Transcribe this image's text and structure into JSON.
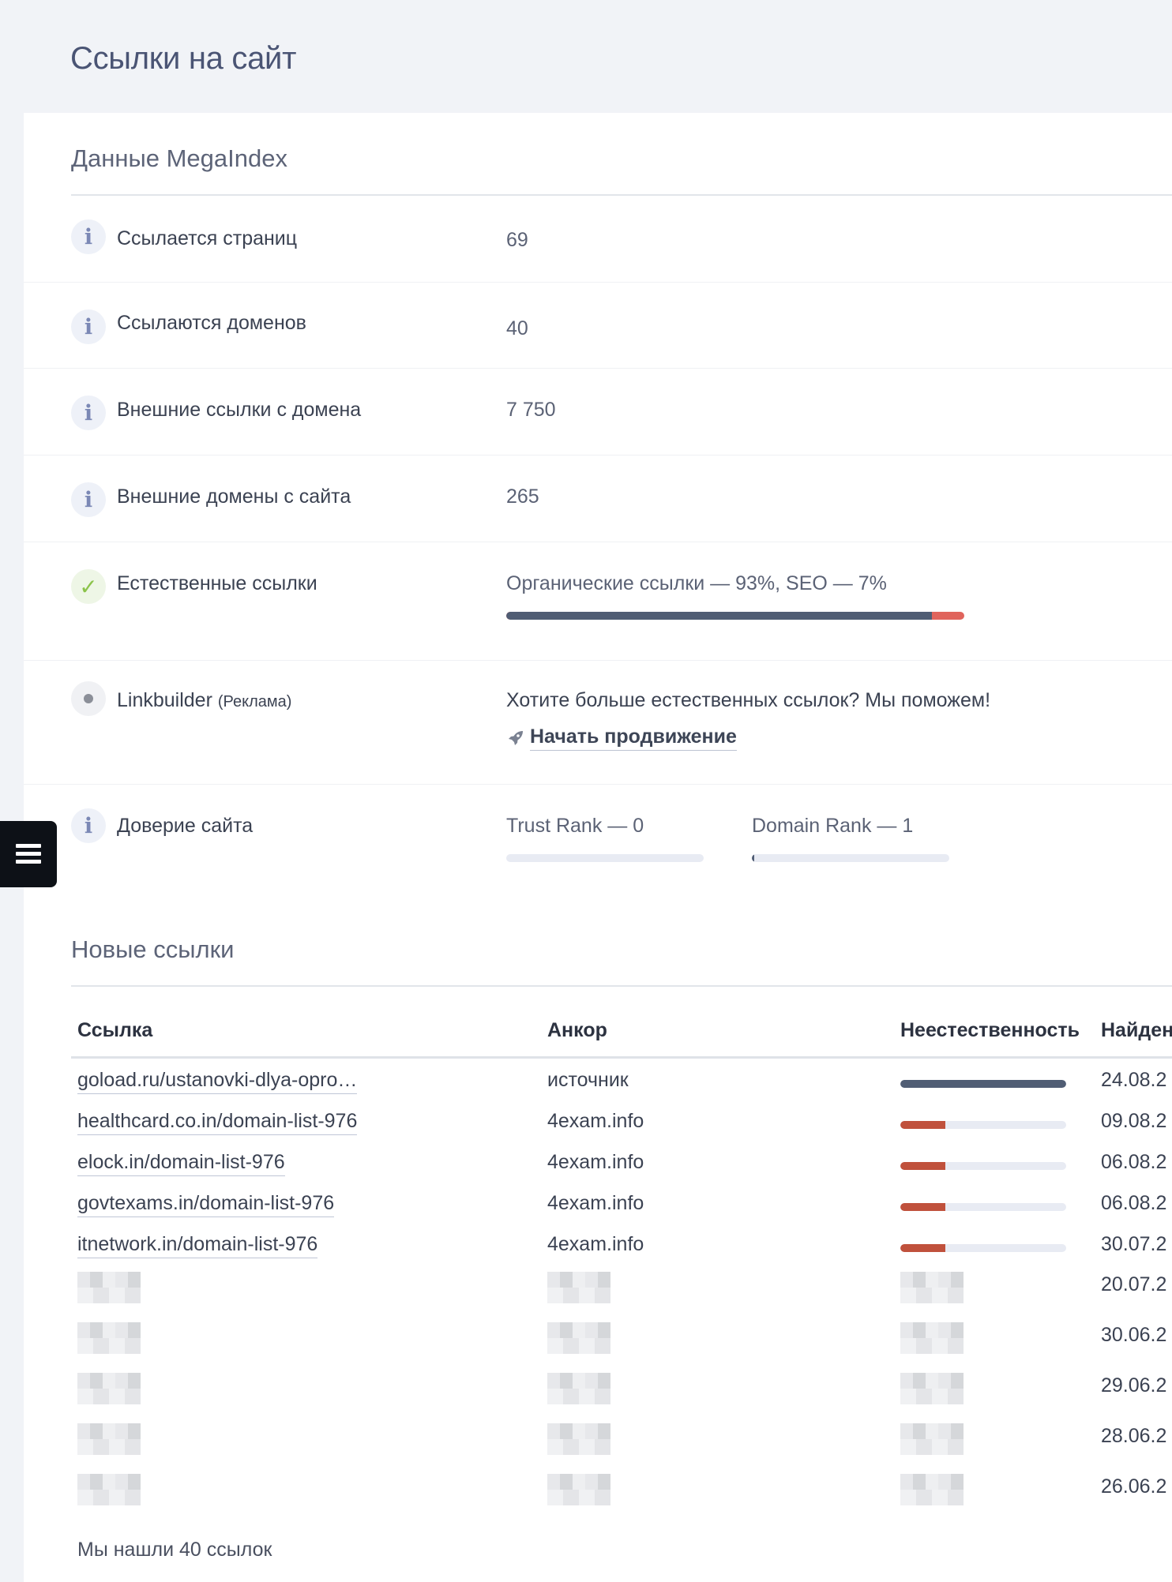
{
  "page": {
    "title": "Ссылки на сайт"
  },
  "megaindex": {
    "title": "Данные MegaIndex",
    "rows": [
      {
        "label": "Ссылается страниц",
        "value": "69"
      },
      {
        "label": "Ссылаются доменов",
        "value": "40"
      },
      {
        "label": "Внешние ссылки с домена",
        "value": "7 750"
      },
      {
        "label": "Внешние домены с сайта",
        "value": "265"
      }
    ],
    "natural": {
      "label": "Естественные ссылки",
      "text": "Органические ссылки — 93%, SEO — 7%",
      "organic_fraction": 0.93,
      "seo_fraction": 0.07,
      "colors": {
        "organic": "#505d74",
        "seo": "#e0645c"
      }
    },
    "linkbuilder": {
      "label": "Linkbuilder",
      "label_note": "(Реклама)",
      "text": "Хотите больше естественных ссылок? Мы поможем!",
      "cta": "Начать продвижение",
      "cta_icon": "rocket-icon"
    },
    "trust": {
      "label": "Доверие сайта",
      "trust_rank": "Trust Rank — 0",
      "trust_rank_value": 0,
      "domain_rank": "Domain Rank — 1",
      "domain_rank_value": 1
    }
  },
  "new_links": {
    "title": "Новые ссылки",
    "columns": [
      "Ссылка",
      "Анкор",
      "Неестественность",
      "Найден"
    ],
    "rows": [
      {
        "link": "goload.ru/ustanovki-dlya-opro…",
        "anchor": "источник",
        "unnatural": 1.0,
        "bar_color": "#505d74",
        "date": "24.08.2"
      },
      {
        "link": "healthcard.co.in/domain-list-976",
        "anchor": "4exam.info",
        "unnatural": 0.27,
        "bar_color": "#c0513c",
        "date": "09.08.2"
      },
      {
        "link": "elock.in/domain-list-976",
        "anchor": "4exam.info",
        "unnatural": 0.27,
        "bar_color": "#c0513c",
        "date": "06.08.2"
      },
      {
        "link": "govtexams.in/domain-list-976",
        "anchor": "4exam.info",
        "unnatural": 0.27,
        "bar_color": "#c0513c",
        "date": "06.08.2"
      },
      {
        "link": "itnetwork.in/domain-list-976",
        "anchor": "4exam.info",
        "unnatural": 0.27,
        "bar_color": "#c0513c",
        "date": "30.07.2"
      }
    ],
    "blurred_dates": [
      "20.07.2",
      "30.06.2",
      "29.06.2",
      "28.06.2",
      "26.06.2"
    ],
    "footer": "Мы нашли 40 ссылок"
  },
  "menu": {
    "icon": "hamburger-icon"
  }
}
